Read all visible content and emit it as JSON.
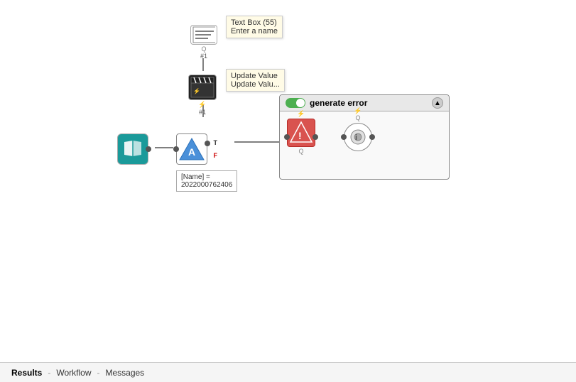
{
  "canvas": {
    "background": "#ffffff"
  },
  "tooltip_textbox": {
    "line1": "Text Box (55)",
    "line2": "Enter a name"
  },
  "tooltip_updatevalue": {
    "line1": "Update Value",
    "line2": "Update Valu..."
  },
  "group": {
    "title": "generate error",
    "toggle_state": "on"
  },
  "value_label": {
    "text": "[Name] =",
    "value": "2022000762406"
  },
  "bottom_bar": {
    "results_label": "Results",
    "workflow_label": "Workflow",
    "messages_label": "Messages"
  }
}
